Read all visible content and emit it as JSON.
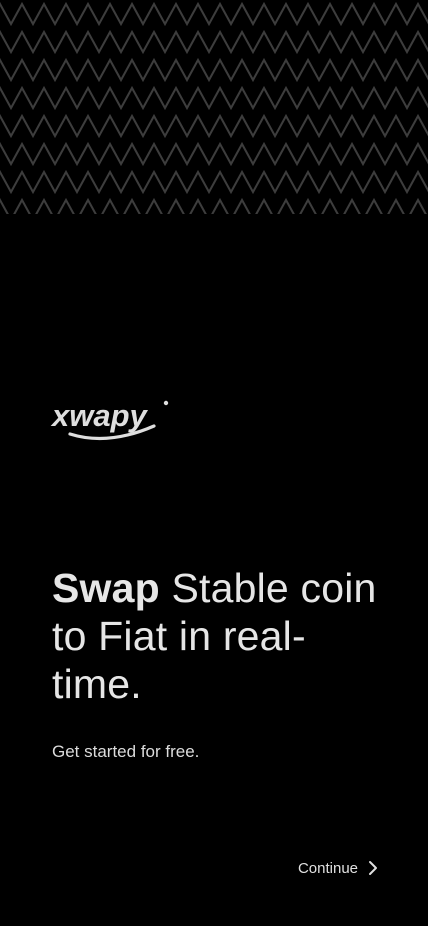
{
  "brand": {
    "logo_text": "xwapy"
  },
  "hero": {
    "headline_strong": "Swap",
    "headline_rest": " Stable coin to Fiat in real-time.",
    "subtitle": "Get started for free."
  },
  "actions": {
    "continue_label": "Continue",
    "continue_icon": "chevron-right-icon"
  },
  "colors": {
    "background": "#000000",
    "pattern_stroke": "#3a3a3a",
    "text": "#e6e6e6"
  }
}
